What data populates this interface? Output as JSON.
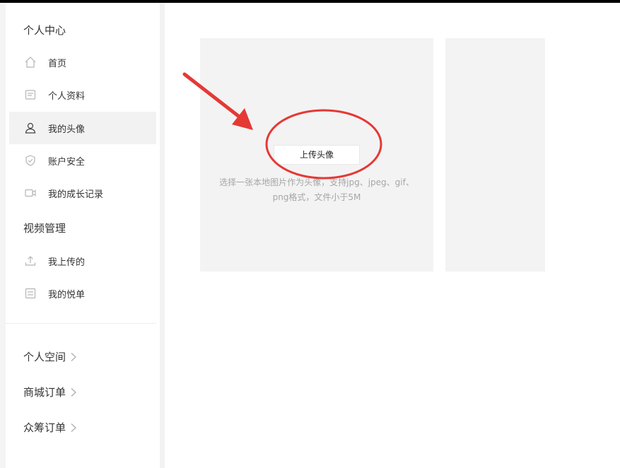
{
  "sidebar": {
    "personal_center": "个人中心",
    "items": [
      {
        "label": "首页",
        "icon": "home-icon"
      },
      {
        "label": "个人资料",
        "icon": "profile-card-icon"
      },
      {
        "label": "我的头像",
        "icon": "user-icon",
        "active": true
      },
      {
        "label": "账户安全",
        "icon": "shield-icon"
      },
      {
        "label": "我的成长记录",
        "icon": "video-camera-icon"
      }
    ],
    "video_management": "视频管理",
    "video_items": [
      {
        "label": "我上传的",
        "icon": "upload-icon"
      },
      {
        "label": "我的悦单",
        "icon": "playlist-icon"
      }
    ],
    "links": [
      {
        "label": "个人空间"
      },
      {
        "label": "商城订单"
      },
      {
        "label": "众筹订单"
      }
    ]
  },
  "avatar": {
    "upload_button": "上传头像",
    "hint_line1": "选择一张本地图片作为头像，支持jpg、jpeg、gif、",
    "hint_line2": "png格式，文件小于5M"
  },
  "colors": {
    "annotation": "#e53935",
    "panel": "#f3f3f3",
    "active_nav": "#f2f2f2"
  }
}
